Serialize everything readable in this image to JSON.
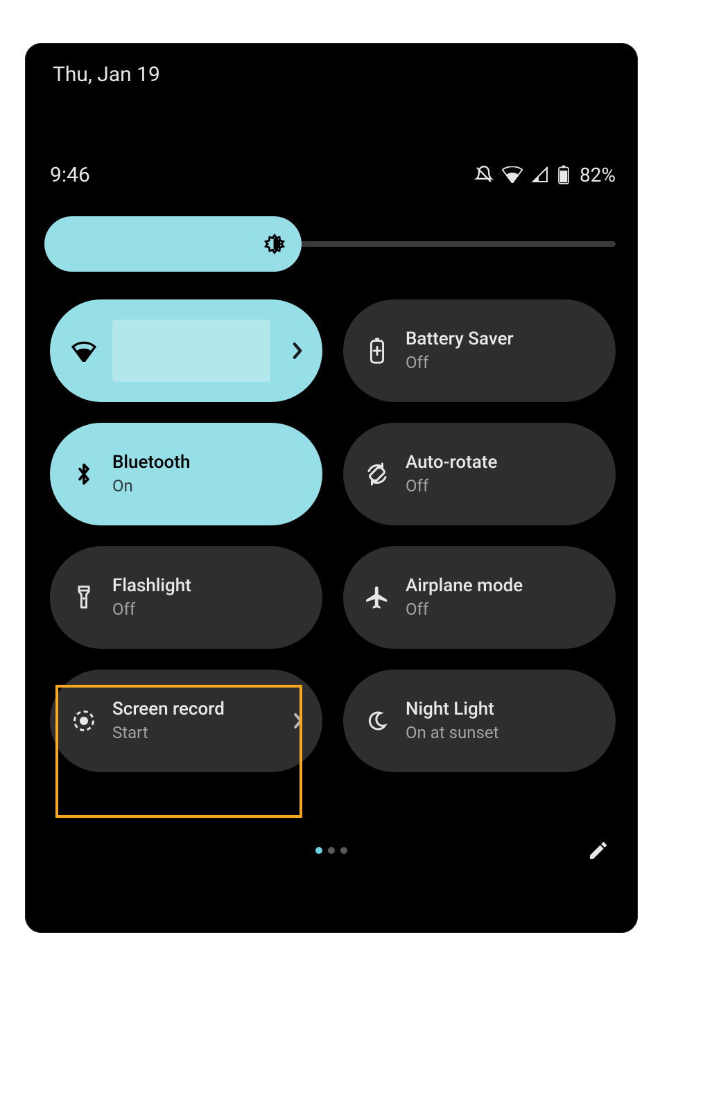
{
  "date": "Thu, Jan 19",
  "status": {
    "time": "9:46",
    "battery_pct": "82%"
  },
  "brightness": {
    "value_pct": 45
  },
  "tiles": [
    {
      "id": "wifi",
      "title": "",
      "sub": "",
      "state": "on",
      "chevron": true,
      "redacted": true
    },
    {
      "id": "battery",
      "title": "Battery Saver",
      "sub": "Off",
      "state": "off",
      "chevron": false
    },
    {
      "id": "bluetooth",
      "title": "Bluetooth",
      "sub": "On",
      "state": "on",
      "chevron": false
    },
    {
      "id": "autorotate",
      "title": "Auto-rotate",
      "sub": "Off",
      "state": "off",
      "chevron": false
    },
    {
      "id": "flashlight",
      "title": "Flashlight",
      "sub": "Off",
      "state": "off",
      "chevron": false
    },
    {
      "id": "airplane",
      "title": "Airplane mode",
      "sub": "Off",
      "state": "off",
      "chevron": false
    },
    {
      "id": "screenrecord",
      "title": "Screen record",
      "sub": "Start",
      "state": "off",
      "chevron": true,
      "highlighted": true
    },
    {
      "id": "nightlight",
      "title": "Night Light",
      "sub": "On at sunset",
      "state": "off",
      "chevron": false
    }
  ],
  "pagination": {
    "current": 1,
    "total": 3
  }
}
